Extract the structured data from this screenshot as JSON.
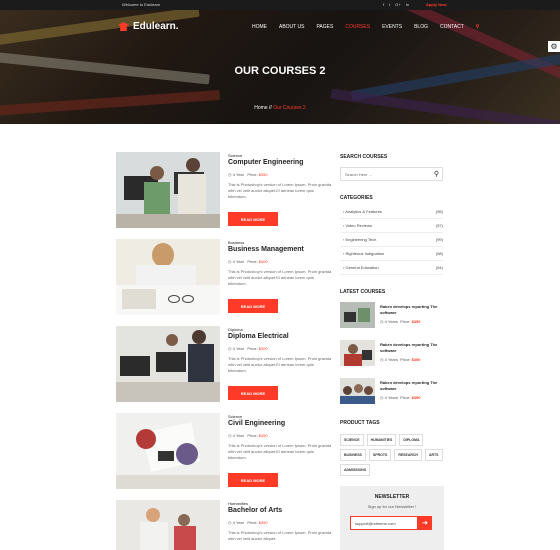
{
  "topbar": {
    "welcome": "Welcome to Edulearn",
    "social": [
      "f",
      "t",
      "G+",
      "in"
    ],
    "apply": "Apply Now"
  },
  "header": {
    "logo_text": "Edulearn.",
    "nav": [
      "HOME",
      "ABOUT US",
      "PAGES",
      "COURSES",
      "EVENTS",
      "BLOG",
      "CONTACT"
    ],
    "active_nav": "COURSES"
  },
  "hero": {
    "title": "OUR COURSES 2",
    "breadcrumb_home": "Home",
    "breadcrumb_sep": "//",
    "breadcrumb_current": "Our Courses 2"
  },
  "courses": [
    {
      "category": "Science",
      "title": "Computer Engineering",
      "duration": "4 Year",
      "price_label": "Price:",
      "price": "$350",
      "desc": "This is Photoshop's version of Lorem Ipsum. Proin gravida nibh vel velit auctor aliquet.El aenean lorem quis bibendum.",
      "button": "READ MORE"
    },
    {
      "category": "Business",
      "title": "Business Management",
      "duration": "4 Year",
      "price_label": "Price:",
      "price": "$400",
      "desc": "This is Photoshop's version of Lorem Ipsum. Proin gravida nibh vel velit auctor aliquet.El aenean lorem quis bibendum.",
      "button": "READ MORE"
    },
    {
      "category": "Diploma",
      "title": "Diploma Electrical",
      "duration": "4 Year",
      "price_label": "Price:",
      "price": "$300",
      "desc": "This is Photoshop's version of Lorem Ipsum. Proin gravida nibh vel velit auctor aliquet.El aenean lorem quis bibendum.",
      "button": "READ MORE"
    },
    {
      "category": "Science",
      "title": "Civil Engineering",
      "duration": "4 Year",
      "price_label": "Price:",
      "price": "$450",
      "desc": "This is Photoshop's version of Lorem Ipsum. Proin gravida nibh vel velit auctor aliquet.El aenean lorem quis bibendum.",
      "button": "READ MORE"
    },
    {
      "category": "Humanities",
      "title": "Bachelor of Arts",
      "duration": "4 Year",
      "price_label": "Price:",
      "price": "$450",
      "desc": "This is Photoshop's version of Lorem Ipsum. Proin gravida nibh vel velit auctor aliquet.",
      "button": "READ MORE"
    }
  ],
  "sidebar": {
    "search_heading": "SEARCH COURSES",
    "search_placeholder": "Search Here ...",
    "categories_heading": "CATEGORIES",
    "categories": [
      {
        "label": "Analytics & Features",
        "count": "(55)"
      },
      {
        "label": "Video Reviews",
        "count": "(57)"
      },
      {
        "label": "Engineering Tech",
        "count": "(99)"
      },
      {
        "label": "Righteous Indignation",
        "count": "(58)"
      },
      {
        "label": "General Education",
        "count": "(54)"
      }
    ],
    "latest_heading": "LATEST COURSES",
    "latest": [
      {
        "title": "Raken develops reporting The software",
        "duration": "4 Years",
        "price_label": "Price:",
        "price": "$350"
      },
      {
        "title": "Raken develops reporting The software",
        "duration": "4 Years",
        "price_label": "Price:",
        "price": "$350"
      },
      {
        "title": "Raken develops reporting The software",
        "duration": "4 Years",
        "price_label": "Price:",
        "price": "$350"
      }
    ],
    "tags_heading": "PRODUCT TAGS",
    "tags": [
      "SCIENCE",
      "HUMANITIES",
      "DIPLOMA",
      "BUSINESS",
      "SPROTS",
      "RESEARCH",
      "ARTS",
      "ADMISSIONS"
    ],
    "newsletter_heading": "NEWSLETTER",
    "newsletter_sub": "Sign up for our Newsletter !",
    "newsletter_placeholder": "support@rstheme.com"
  },
  "colors": {
    "accent": "#ff3a27",
    "dark": "#1b1b1b"
  }
}
